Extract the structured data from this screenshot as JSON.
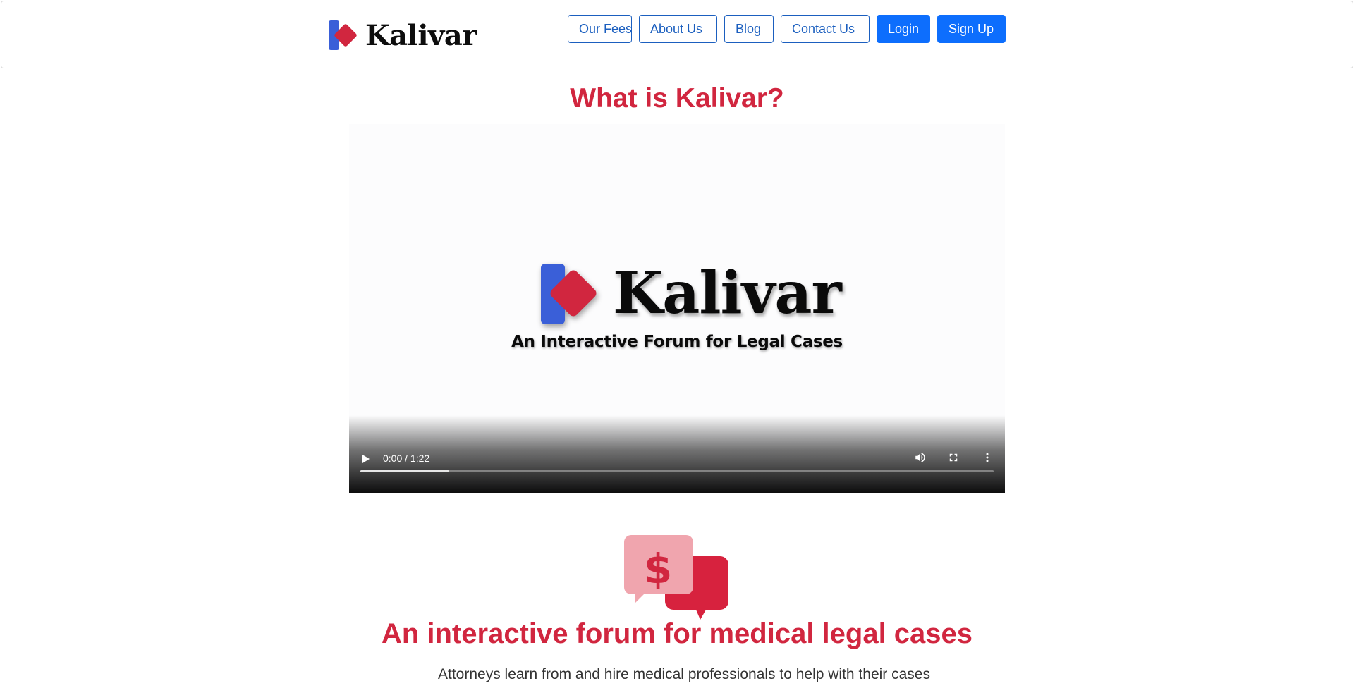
{
  "header": {
    "brand": "Kalivar",
    "nav": {
      "fees": "Our Fees",
      "about": "About Us",
      "blog": "Blog",
      "contact": "Contact Us",
      "login": "Login",
      "signup": "Sign Up"
    }
  },
  "main": {
    "video_heading": "What is Kalivar?",
    "video": {
      "brand": "Kalivar",
      "tagline": "An Interactive Forum for Legal Cases",
      "time": "0:00 / 1:22",
      "buffered_fraction": 0.14
    },
    "feature_heading": "An interactive forum for medical legal cases",
    "feature_text": "Attorneys learn from and hire medical professionals to help with their cases"
  },
  "colors": {
    "brand_red": "#d1263f",
    "brand_blue": "#3a5fd8",
    "primary_button": "#0d6efd",
    "outline_button": "#1b5fbf"
  },
  "icons": [
    "kalivar-logo-icon",
    "play-icon",
    "volume-icon",
    "fullscreen-icon",
    "more-options-icon",
    "money-chat-icon"
  ]
}
